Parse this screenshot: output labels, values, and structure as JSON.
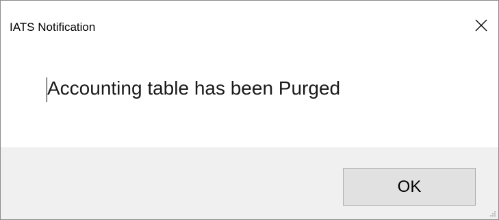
{
  "window": {
    "title": "IATS Notification",
    "close_icon": "close-icon"
  },
  "message": {
    "text": "Accounting table has been Purged"
  },
  "buttons": {
    "ok_label": "OK"
  },
  "colors": {
    "footer_background": "#f0f0f0",
    "button_background": "#e1e1e1",
    "button_border": "#adadad"
  }
}
